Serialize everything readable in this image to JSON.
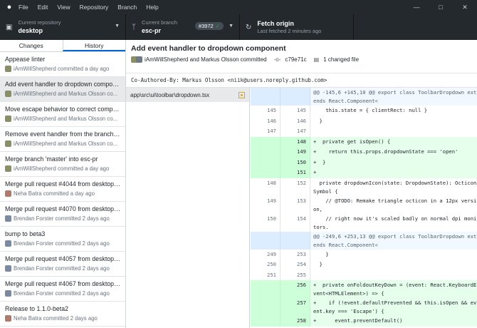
{
  "menu": [
    "File",
    "Edit",
    "View",
    "Repository",
    "Branch",
    "Help"
  ],
  "toolbar": {
    "repo_label": "Current repository",
    "repo_value": "desktop",
    "branch_label": "Current branch",
    "branch_value": "esc-pr",
    "pr_badge": "#3972",
    "fetch_label": "Fetch origin",
    "fetch_sub": "Last fetched 2 minutes ago"
  },
  "tabs": {
    "changes": "Changes",
    "history": "History"
  },
  "commits": [
    {
      "summary": "Appease linter",
      "meta": "iAmWillShepherd committed a day ago",
      "color": "#8a8f66"
    },
    {
      "summary": "Add event handler to dropdown compon...",
      "meta": "iAmWillShepherd and Markus Olsson co...",
      "color": "#8a8f66"
    },
    {
      "summary": "Move escape behavior to correct compo...",
      "meta": "iAmWillShepherd and Markus Olsson co...",
      "color": "#8a8f66"
    },
    {
      "summary": "Remove event handler from the branches...",
      "meta": "iAmWillShepherd and Markus Olsson co...",
      "color": "#8a8f66"
    },
    {
      "summary": "Merge branch 'master' into esc-pr",
      "meta": "iAmWillShepherd committed a day ago",
      "color": "#8a8f66"
    },
    {
      "summary": "Merge pull request #4044 from desktop/...",
      "meta": "Neha Batra committed a day ago",
      "color": "#b07a6a"
    },
    {
      "summary": "Merge pull request #4070 from desktop/...",
      "meta": "Brendan Forster committed 2 days ago",
      "color": "#7a8aa0"
    },
    {
      "summary": "bump to beta3",
      "meta": "Brendan Forster committed 2 days ago",
      "color": "#7a8aa0"
    },
    {
      "summary": "Merge pull request #4057 from desktop/...",
      "meta": "Brendan Forster committed 2 days ago",
      "color": "#7a8aa0"
    },
    {
      "summary": "Merge pull request #4067 from desktop/...",
      "meta": "Brendan Forster committed 2 days ago",
      "color": "#7a8aa0"
    },
    {
      "summary": "Release to 1.1.0-beta2",
      "meta": "Neha Batra committed 2 days ago",
      "color": "#b07a6a"
    }
  ],
  "commit": {
    "title": "Add event handler to dropdown component",
    "authors": "iAmWillShepherd and Markus Olsson committed",
    "sha": "c79e71c",
    "files_changed": "1 changed file",
    "description": "Co-Authored-By: Markus Olsson <niik@users.noreply.github.com>"
  },
  "file": {
    "path": "app\\src\\ui\\toolbar\\dropdown.tsx"
  },
  "diff": [
    {
      "t": "hunk",
      "o": "",
      "n": "",
      "c": "@@ -145,6 +145,10 @@ export class ToolbarDropdown extends React.Component<"
    },
    {
      "t": "ctx",
      "o": "145",
      "n": "145",
      "c": "    this.state = { clientRect: null }"
    },
    {
      "t": "ctx",
      "o": "146",
      "n": "146",
      "c": "  }"
    },
    {
      "t": "ctx",
      "o": "147",
      "n": "147",
      "c": ""
    },
    {
      "t": "add",
      "o": "",
      "n": "148",
      "c": "+  private get isOpen() {"
    },
    {
      "t": "add",
      "o": "",
      "n": "149",
      "c": "+    return this.props.dropdownState === 'open'"
    },
    {
      "t": "add",
      "o": "",
      "n": "150",
      "c": "+  }"
    },
    {
      "t": "add",
      "o": "",
      "n": "151",
      "c": "+"
    },
    {
      "t": "ctx",
      "o": "148",
      "n": "152",
      "c": "  private dropdownIcon(state: DropdownState): OcticonSymbol {"
    },
    {
      "t": "ctx",
      "o": "149",
      "n": "153",
      "c": "    // @TODO: Remake triangle octicon in a 12px version,"
    },
    {
      "t": "ctx",
      "o": "150",
      "n": "154",
      "c": "    // right now it's scaled badly on normal dpi monitors."
    },
    {
      "t": "hunk",
      "o": "",
      "n": "",
      "c": "@@ -249,6 +253,13 @@ export class ToolbarDropdown extends React.Component<"
    },
    {
      "t": "ctx",
      "o": "249",
      "n": "253",
      "c": "    }"
    },
    {
      "t": "ctx",
      "o": "250",
      "n": "254",
      "c": "  }"
    },
    {
      "t": "ctx",
      "o": "251",
      "n": "255",
      "c": ""
    },
    {
      "t": "add",
      "o": "",
      "n": "256",
      "c": "+  private onFoldoutKeyDown = (event: React.KeyboardEvent<HTMLElement>) => {"
    },
    {
      "t": "add",
      "o": "",
      "n": "257",
      "c": "+    if (!event.defaultPrevented && this.isOpen && event.key === 'Escape') {"
    },
    {
      "t": "add",
      "o": "",
      "n": "258",
      "c": "+      event.preventDefault()"
    }
  ]
}
